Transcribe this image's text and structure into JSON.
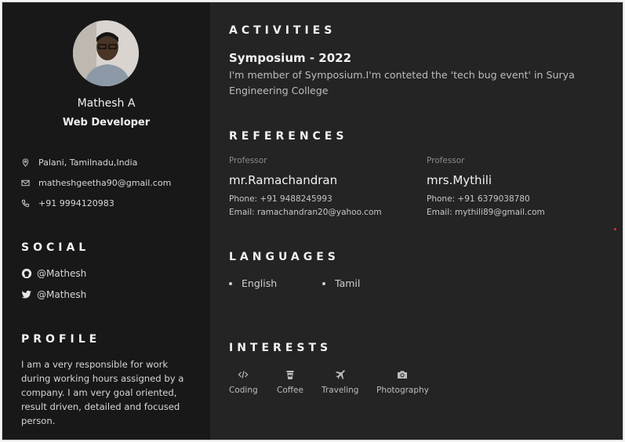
{
  "person": {
    "name": "Mathesh A",
    "role": "Web Developer"
  },
  "contact": {
    "location": "Palani, Tamilnadu,India",
    "email": "matheshgeetha90@gmail.com",
    "phone": "+91 9994120983"
  },
  "social": {
    "title": "SOCIAL",
    "github": "@Mathesh",
    "twitter": "@Mathesh"
  },
  "profile": {
    "title": "PROFILE",
    "text": "I am a very responsible for work during working hours assigned by a company. I am very goal oriented, result driven, detailed and focused person."
  },
  "activities": {
    "title": "ACTIVITIES",
    "item_title": "Symposium - 2022",
    "item_desc": "I'm member of Symposium.I'm conteted the 'tech bug event' in Surya Engineering College"
  },
  "references": {
    "title": "REFERENCES",
    "items": [
      {
        "tag": "Professor",
        "name": "mr.Ramachandran",
        "phone": "Phone: +91 9488245993",
        "email": "Email: ramachandran20@yahoo.com"
      },
      {
        "tag": "Professor",
        "name": "mrs.Mythili",
        "phone": "Phone: +91 6379038780",
        "email": "Email: mythili89@gmail.com"
      }
    ]
  },
  "languages": {
    "title": "LANGUAGES",
    "items": [
      "English",
      "Tamil"
    ]
  },
  "interests": {
    "title": "INTERESTS",
    "items": [
      {
        "label": "Coding",
        "icon": "code-icon"
      },
      {
        "label": "Coffee",
        "icon": "coffee-icon"
      },
      {
        "label": "Traveling",
        "icon": "plane-icon"
      },
      {
        "label": "Photography",
        "icon": "camera-icon"
      }
    ]
  },
  "colors": {
    "sidebar_bg": "#181818",
    "main_bg": "#242424",
    "text": "#f2f2f2",
    "muted": "#8a8a8a"
  }
}
